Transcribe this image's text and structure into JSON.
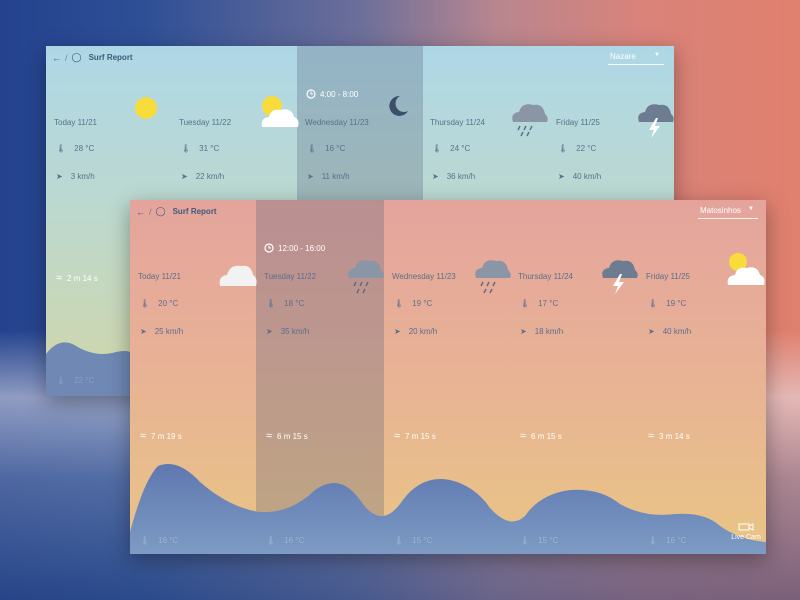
{
  "back": {
    "title": "Surf Report",
    "location": "Nazare",
    "time_range": "4:00 - 8:00",
    "days": [
      {
        "label": "Today  11/21",
        "icon": "sun-icon",
        "temp": "28 °C",
        "wind": "3 km/h"
      },
      {
        "label": "Tuesday  11/22",
        "icon": "sun-cloud-icon",
        "temp": "31 °C",
        "wind": "22 km/h"
      },
      {
        "label": "Wednesday  11/23",
        "icon": "moon-icon",
        "temp": "16 °C",
        "wind": "11 km/h"
      },
      {
        "label": "Thursday  11/24",
        "icon": "rain-cloud-icon",
        "temp": "24 °C",
        "wind": "36 km/h"
      },
      {
        "label": "Friday  11/25",
        "icon": "storm-cloud-icon",
        "temp": "22 °C",
        "wind": "40 km/h"
      }
    ],
    "wave": "2 m  14 s",
    "water_temp": "22 °C"
  },
  "front": {
    "title": "Surf Report",
    "location": "Matosinhos",
    "time_range": "12:00 - 16:00",
    "days": [
      {
        "label": "Today  11/21",
        "icon": "cloud-icon",
        "temp": "20 °C",
        "wind": "25 km/h",
        "wave": "7 m  19 s",
        "water": "16 °C"
      },
      {
        "label": "Tuesday  11/22",
        "icon": "rain-cloud-icon",
        "temp": "18 °C",
        "wind": "35 km/h",
        "wave": "6 m  15 s",
        "water": "16 °C"
      },
      {
        "label": "Wednesday  11/23",
        "icon": "rain-cloud-icon",
        "temp": "19 °C",
        "wind": "20 km/h",
        "wave": "7 m  15 s",
        "water": "15 °C"
      },
      {
        "label": "Thursday  11/24",
        "icon": "storm-cloud-icon",
        "temp": "17 °C",
        "wind": "18 km/h",
        "wave": "6 m  15 s",
        "water": "15 °C"
      },
      {
        "label": "Friday  11/25",
        "icon": "sun-cloud-icon",
        "temp": "19 °C",
        "wind": "40 km/h",
        "wave": "3 m  14 s",
        "water": "16 °C"
      }
    ],
    "live_cam": "Live Cam"
  }
}
